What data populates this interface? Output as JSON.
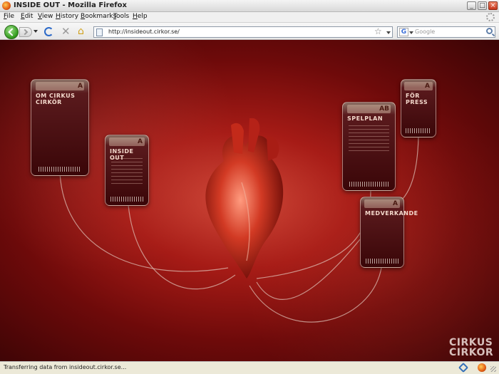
{
  "window": {
    "title": "INSIDE OUT - Mozilla Firefox",
    "buttons": {
      "minimize": "_",
      "maximize": "□",
      "close": "×"
    }
  },
  "menu": {
    "items": [
      {
        "label": "File",
        "underline": "F",
        "rest": "ile"
      },
      {
        "label": "Edit",
        "underline": "E",
        "rest": "dit"
      },
      {
        "label": "View",
        "underline": "V",
        "rest": "iew"
      },
      {
        "label": "History",
        "underline": "H",
        "rest": "istory"
      },
      {
        "label": "Bookmarks",
        "underline": "B",
        "rest": "ookmarks"
      },
      {
        "label": "Tools",
        "underline": "T",
        "rest": "ools"
      },
      {
        "label": "Help",
        "underline": "H",
        "rest": "elp"
      }
    ]
  },
  "nav": {
    "url": "http://insideout.cirkor.se/",
    "search_placeholder": "Google",
    "search_engine_letter": "G",
    "icons": {
      "stop": "✕",
      "home": "⌂",
      "star": "☆"
    }
  },
  "page": {
    "bags": [
      {
        "title": "OM CIRKUS CIRKÖR",
        "code": "A"
      },
      {
        "title": "INSIDE OUT",
        "code": "A"
      },
      {
        "title": "SPELPLAN",
        "code": "AB"
      },
      {
        "title": "FÖR PRESS",
        "code": "A"
      },
      {
        "title": "MEDVERKANDE",
        "code": "A"
      }
    ],
    "brand_line1": "CIRKUS",
    "brand_line2": "CIRKOR"
  },
  "status": {
    "text": "Transferring data from insideout.cirkor.se..."
  },
  "colors": {
    "background_red": "#a61b16",
    "back_button_green": "#2f9a1a"
  }
}
